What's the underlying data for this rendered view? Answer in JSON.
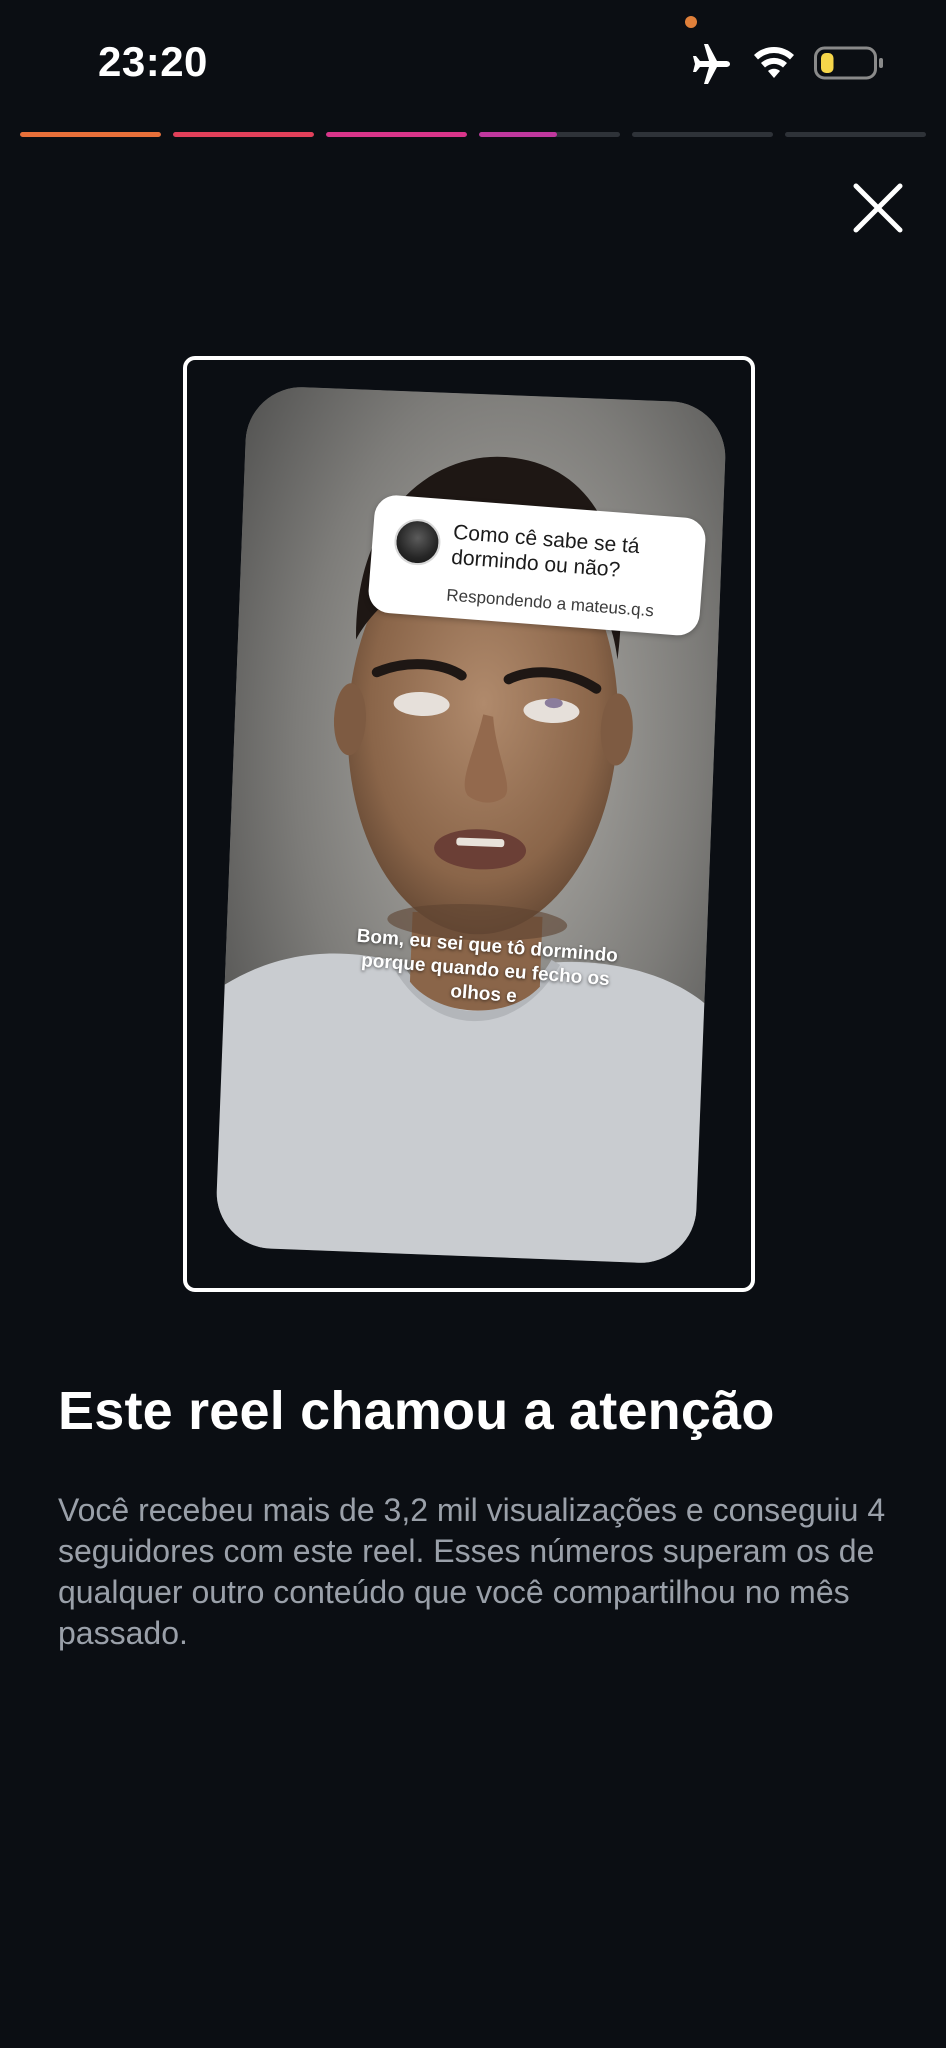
{
  "status_bar": {
    "time": "23:20",
    "icons": [
      "airplane-icon",
      "wifi-icon",
      "battery-icon"
    ],
    "battery_level": 0.25,
    "colors": {
      "privacy_dot": "#e0803a",
      "battery_fill": "#f6d64a"
    }
  },
  "progress": {
    "segments": [
      {
        "fill": 1.0,
        "color": "#e8703a"
      },
      {
        "fill": 1.0,
        "color": "#e2405a"
      },
      {
        "fill": 1.0,
        "color": "#d9358a"
      },
      {
        "fill": 0.55,
        "color": "#c0389e"
      },
      {
        "fill": 0.0,
        "color": "#2e3238"
      },
      {
        "fill": 0.0,
        "color": "#2e3238"
      }
    ]
  },
  "close": {
    "icon": "close-icon"
  },
  "reel": {
    "sticker": {
      "question": "Como cê sabe se tá dormindo ou não?",
      "reply": "Respondendo a mateus.q.s"
    },
    "caption": "Bom, eu sei que tô dormindo porque quando eu fecho os olhos e"
  },
  "content": {
    "headline": "Este reel chamou a atenção",
    "description": "Você recebeu mais de 3,2 mil visualizações e conseguiu 4 seguidores com este reel. Esses números superam os de qualquer outro conteúdo que você compartilhou no mês passado."
  },
  "theme": {
    "background": "#0b0e13",
    "headline_color": "#ffffff",
    "description_color": "#9aa0a9"
  }
}
